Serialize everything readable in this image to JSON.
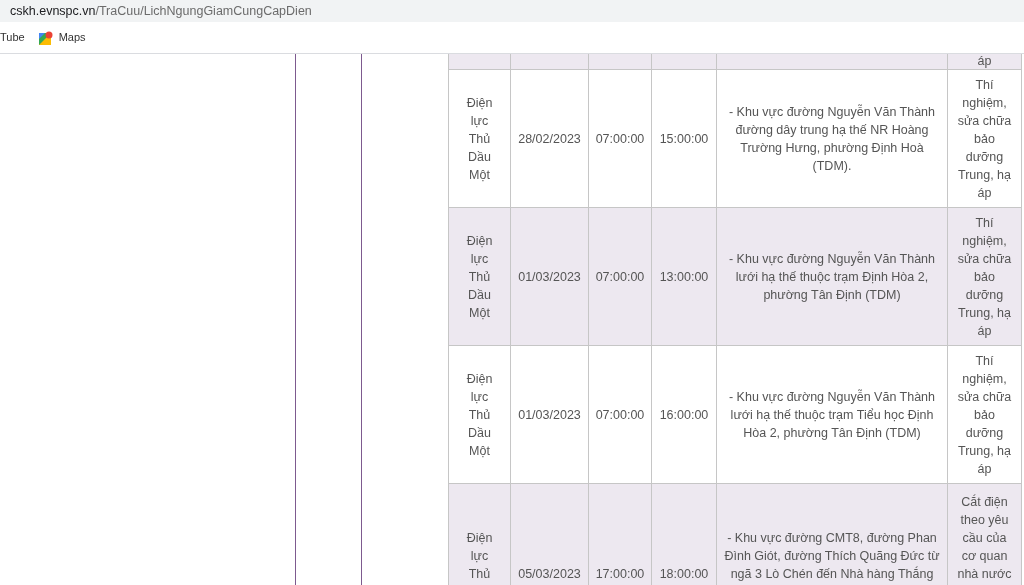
{
  "address_bar": {
    "domain": "cskh.evnspc.vn",
    "path": "/TraCuu/LichNgungGiamCungCapDien"
  },
  "bookmarks": [
    {
      "label": "Tube",
      "kind": "plain"
    },
    {
      "label": "Maps",
      "kind": "maps"
    }
  ],
  "table": {
    "top_partial_row": {
      "reason": "áp"
    },
    "rows": [
      {
        "unit": "Điện lực Thủ Dầu Một",
        "date": "28/02/2023",
        "start": "07:00:00",
        "end": "15:00:00",
        "area": "- Khu vực đường Nguyễn Văn Thành đường dây trung hạ thế NR Hoàng Trường Hưng, phường Định Hoà (TDM).",
        "reason": "Thí nghiệm, sửa chữa bảo dưỡng Trung, hạ áp"
      },
      {
        "unit": "Điện lực Thủ Dầu Một",
        "date": "01/03/2023",
        "start": "07:00:00",
        "end": "13:00:00",
        "area": "- Khu vực đường Nguyễn Văn Thành lưới hạ thế thuộc trạm Định Hòa 2, phường Tân Định (TDM)",
        "reason": "Thí nghiệm, sửa chữa bảo dưỡng Trung, hạ áp"
      },
      {
        "unit": "Điện lực Thủ Dầu Một",
        "date": "01/03/2023",
        "start": "07:00:00",
        "end": "16:00:00",
        "area": "- Khu vực đường Nguyễn Văn Thành lưới hạ thế thuộc trạm Tiểu học Định Hòa 2, phường Tân Định (TDM)",
        "reason": "Thí nghiệm, sửa chữa bảo dưỡng Trung, hạ áp"
      },
      {
        "unit": "Điện lực Thủ",
        "date": "05/03/2023",
        "start": "17:00:00",
        "end": "18:00:00",
        "area": "- Khu vực đường CMT8, đường Phan Đình Giót, đường Thích Quãng Đức từ ngã 3 Lò Chén đến Nhà hàng Thắng",
        "reason": "Cắt điện theo yêu cầu của cơ quan nhà nước"
      }
    ]
  }
}
